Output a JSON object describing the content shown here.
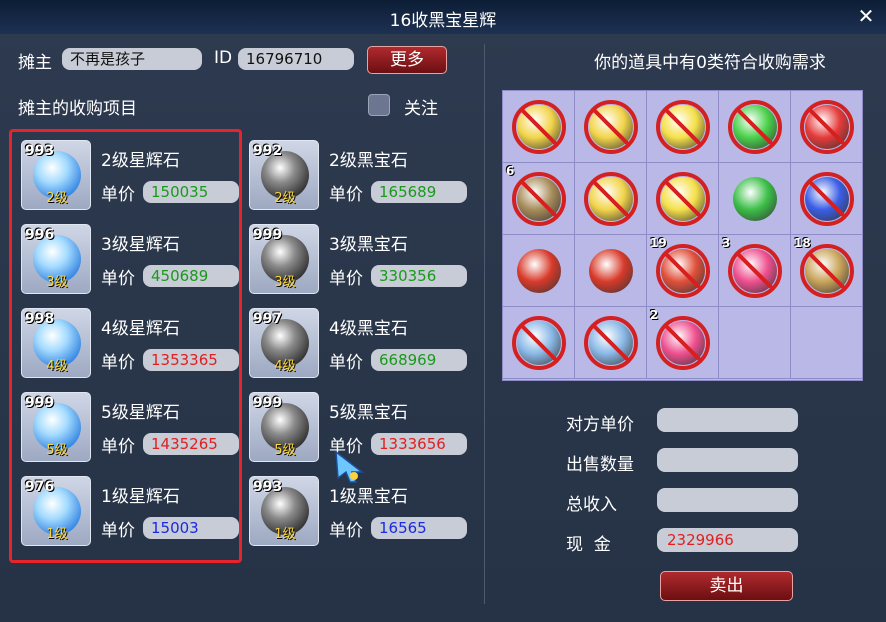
{
  "window": {
    "title": "16收黑宝星辉",
    "close_glyph": "✕"
  },
  "header": {
    "owner_label": "摊主",
    "owner_name": "不再是孩子",
    "id_label": "ID",
    "id_value": "16796710",
    "more_button": "更多",
    "section_title": "摊主的收购项目",
    "follow_label": "关注"
  },
  "left_items": [
    {
      "count": "993",
      "grade": "2级",
      "name": "2级星辉石",
      "price_label": "单价",
      "price": "150035",
      "price_color": "#1a9a1a"
    },
    {
      "count": "996",
      "grade": "3级",
      "name": "3级星辉石",
      "price_label": "单价",
      "price": "450689",
      "price_color": "#1a9a1a"
    },
    {
      "count": "998",
      "grade": "4级",
      "name": "4级星辉石",
      "price_label": "单价",
      "price": "1353365",
      "price_color": "#e02020"
    },
    {
      "count": "999",
      "grade": "5级",
      "name": "5级星辉石",
      "price_label": "单价",
      "price": "1435265",
      "price_color": "#e02020"
    },
    {
      "count": "976",
      "grade": "1级",
      "name": "1级星辉石",
      "price_label": "单价",
      "price": "15003",
      "price_color": "#1a2ae0"
    }
  ],
  "right_items": [
    {
      "count": "992",
      "grade": "2级",
      "name": "2级黑宝石",
      "price_label": "单价",
      "price": "165689",
      "price_color": "#1a9a1a"
    },
    {
      "count": "999",
      "grade": "3级",
      "name": "3级黑宝石",
      "price_label": "单价",
      "price": "330356",
      "price_color": "#1a9a1a"
    },
    {
      "count": "997",
      "grade": "4级",
      "name": "4级黑宝石",
      "price_label": "单价",
      "price": "668969",
      "price_color": "#1a9a1a"
    },
    {
      "count": "999",
      "grade": "5级",
      "name": "5级黑宝石",
      "price_label": "单价",
      "price": "1333656",
      "price_color": "#e02020"
    },
    {
      "count": "993",
      "grade": "1级",
      "name": "1级黑宝石",
      "price_label": "单价",
      "price": "16565",
      "price_color": "#1a2ae0"
    }
  ],
  "inventory": {
    "info": "你的道具中有0类符合收购需求",
    "cells": [
      {
        "count": "",
        "icon": "feather-yellow-icon",
        "banned": true
      },
      {
        "count": "",
        "icon": "feather-yellow-icon",
        "banned": true
      },
      {
        "count": "",
        "icon": "flag-yellow-icon",
        "banned": true
      },
      {
        "count": "",
        "icon": "flag-green-icon",
        "banned": true
      },
      {
        "count": "",
        "icon": "flag-red-icon",
        "banned": true
      },
      {
        "count": "6",
        "icon": "scroll-icon",
        "banned": true
      },
      {
        "count": "",
        "icon": "feather-yellow-icon",
        "banned": true
      },
      {
        "count": "",
        "icon": "flag-yellow-icon",
        "banned": true
      },
      {
        "count": "",
        "icon": "green-orb-icon",
        "banned": false
      },
      {
        "count": "",
        "icon": "flag-blue-icon",
        "banned": true
      },
      {
        "count": "",
        "icon": "red-pouch-icon",
        "banned": false
      },
      {
        "count": "",
        "icon": "red-pouch-icon",
        "banned": false
      },
      {
        "count": "19",
        "icon": "shrimp-icon",
        "banned": true
      },
      {
        "count": "3",
        "icon": "pink-pearl-icon",
        "banned": true
      },
      {
        "count": "18",
        "icon": "book-icon",
        "banned": true
      },
      {
        "count": "",
        "icon": "potion-blue-icon",
        "banned": true
      },
      {
        "count": "",
        "icon": "potion-blue-icon",
        "banned": true
      },
      {
        "count": "2",
        "icon": "pink-pearl-icon",
        "banned": true
      },
      {
        "count": "",
        "icon": "empty",
        "banned": false
      },
      {
        "count": "",
        "icon": "empty",
        "banned": false
      }
    ]
  },
  "form": {
    "unit_price_label": "对方单价",
    "quantity_label": "出售数量",
    "total_label": "总收入",
    "cash_label": "现  金",
    "unit_price_value": "",
    "quantity_value": "",
    "total_value": "",
    "cash_value": "2329966",
    "sell_button": "卖出"
  },
  "colors": {
    "price_green": "#1a9a1a",
    "price_red": "#e02020",
    "price_blue": "#1a2ae0",
    "accent_red": "#e7242b"
  }
}
